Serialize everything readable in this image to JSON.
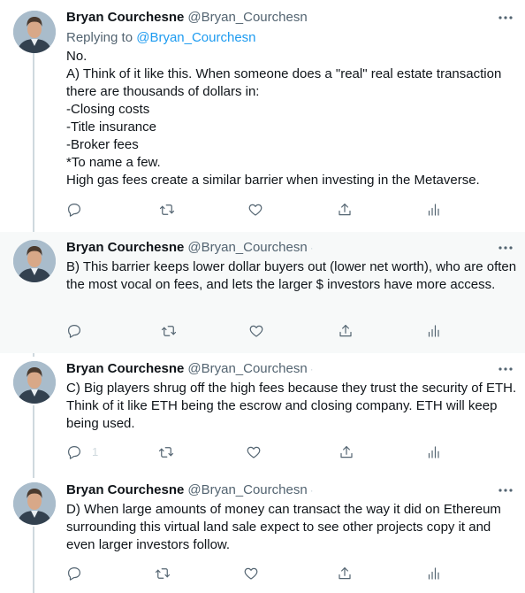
{
  "author": {
    "name": "Bryan Courchesne",
    "handle": "@Bryan_Courchesn"
  },
  "separator": "·",
  "replying": {
    "prefix": "Replying to",
    "mention": "@Bryan_Courchesn"
  },
  "tweets": [
    {
      "lines": [
        "No.",
        "A) Think of it like this. When someone does a \"real\" real estate transaction there are thousands of dollars in:",
        "-Closing costs",
        "-Title insurance",
        "-Broker fees",
        "*To name a few.",
        "High gas fees create a similar barrier when investing in the Metaverse."
      ]
    },
    {
      "lines": [
        "B) This barrier keeps lower dollar buyers out (lower net worth), who are often the most vocal on fees, and lets the larger $ investors have more access."
      ]
    },
    {
      "lines": [
        "C) Big players shrug off the high fees because they trust the security of ETH. Think of it like ETH being the escrow and closing company. ETH will keep being used."
      ],
      "reply_count": "1"
    },
    {
      "lines": [
        "D) When large amounts of money can transact the way it did on Ethereum surrounding this virtual land sale expect to see other projects copy it and even larger investors follow."
      ]
    }
  ],
  "icons": {
    "reply": "reply-icon",
    "retweet": "retweet-icon",
    "like": "like-icon",
    "share": "share-icon",
    "analytics": "analytics-icon",
    "more": "more-icon"
  },
  "colors": {
    "text": "#0f1419",
    "secondary": "#536471",
    "link": "#1d9bf0",
    "thread_line": "#cfd9de",
    "hover_bg": "#f7f9f9"
  }
}
